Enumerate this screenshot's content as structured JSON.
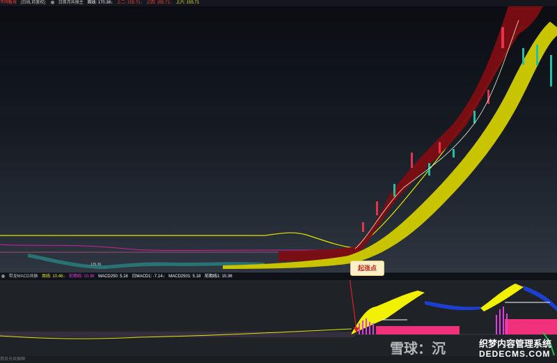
{
  "topbar": {
    "name": "不同板块",
    "kline_label": "(日线,前复权)",
    "indicator": "日周月共振主",
    "weekly": "周线: 170.38↓",
    "up2": "上二: 155.71↓",
    "up4": "上四: 155.71↓",
    "up6": "上六: 155.71"
  },
  "price_label": "135.36",
  "callout": "起涨点",
  "indicator_bar": {
    "name": "带龙MACD共振",
    "weekly": "周线: 10.46↓",
    "top": "前期线: 10.36",
    "macd250": "MACD250: 5.18",
    "macd1": "日MACD1: -7.14↓",
    "macd2501": "MACD2501: 5.18",
    "front": "前期线1: 10.36"
  },
  "bottombar": "用日光共振图",
  "watermark": {
    "logo": "雪球：沉",
    "site": "织梦内容管理系统",
    "domain": "DEDECMS.COM"
  },
  "colors": {
    "up": "#e8334a",
    "down": "#22c1a4",
    "yellow": "#e6e600",
    "magenta": "#e0208c",
    "darkred": "#8b0d14",
    "blue": "#1c3fd0"
  }
}
